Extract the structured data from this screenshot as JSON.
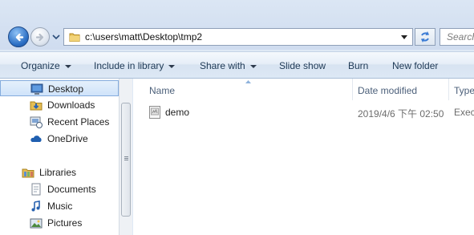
{
  "address_bar": {
    "path": "c:\\users\\matt\\Desktop\\tmp2",
    "search_placeholder": "Search"
  },
  "command_bar": {
    "organize": "Organize",
    "include_in_library": "Include in library",
    "share_with": "Share with",
    "slide_show": "Slide show",
    "burn": "Burn",
    "new_folder": "New folder"
  },
  "navigation": {
    "favorites": [
      {
        "label": "Desktop",
        "icon": "desktop-icon"
      },
      {
        "label": "Downloads",
        "icon": "downloads-icon"
      },
      {
        "label": "Recent Places",
        "icon": "recent-places-icon"
      },
      {
        "label": "OneDrive",
        "icon": "onedrive-icon"
      }
    ],
    "libraries_label": "Libraries",
    "libraries": [
      {
        "label": "Documents",
        "icon": "documents-icon"
      },
      {
        "label": "Music",
        "icon": "music-icon"
      },
      {
        "label": "Pictures",
        "icon": "pictures-icon"
      }
    ]
  },
  "columns": {
    "name": "Name",
    "date_modified": "Date modified",
    "type": "Type"
  },
  "files": [
    {
      "name": "demo",
      "date_modified": "2019/4/6 下午 02:50",
      "type": "Execu"
    }
  ],
  "colors": {
    "accent": "#2c6fc4",
    "selection": "#cfe3fa",
    "command_text": "#1e3955",
    "header_text": "#4c607a"
  }
}
